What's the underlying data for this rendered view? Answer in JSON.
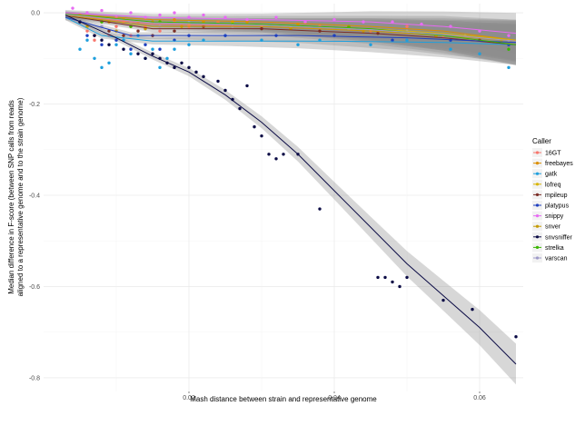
{
  "chart_data": {
    "type": "scatter",
    "title": "",
    "xlabel": "Mash distance between strain and representative genome",
    "ylabel_lines": [
      "Median difference in F-score (between SNP calls from reads",
      "aligned to a representative genome and to the strain genome)"
    ],
    "xlim": [
      0.0,
      0.066
    ],
    "ylim": [
      -0.83,
      0.02
    ],
    "x_ticks": [
      0.02,
      0.04,
      0.06
    ],
    "x_tick_labels": [
      "0.02",
      "0.04",
      "0.06"
    ],
    "y_ticks": [
      0.0,
      -0.2,
      -0.4,
      -0.6,
      -0.8
    ],
    "y_tick_labels": [
      "0.0",
      "-0.2",
      "-0.4",
      "-0.6",
      "-0.8"
    ],
    "grid": true,
    "legend": {
      "title": "Caller",
      "position": "right"
    },
    "series": [
      {
        "name": "16GT",
        "color": "#f8766d",
        "points": [
          [
            0.005,
            -0.01
          ],
          [
            0.006,
            -0.04
          ],
          [
            0.007,
            -0.06
          ],
          [
            0.008,
            -0.02
          ],
          [
            0.009,
            -0.05
          ],
          [
            0.01,
            -0.03
          ],
          [
            0.011,
            -0.02
          ],
          [
            0.012,
            -0.05
          ],
          [
            0.014,
            -0.03
          ],
          [
            0.016,
            -0.04
          ],
          [
            0.018,
            -0.02
          ],
          [
            0.02,
            -0.03
          ],
          [
            0.024,
            -0.02
          ],
          [
            0.03,
            -0.03
          ],
          [
            0.038,
            -0.03
          ],
          [
            0.045,
            -0.04
          ],
          [
            0.05,
            -0.03
          ],
          [
            0.055,
            -0.05
          ],
          [
            0.06,
            -0.06
          ],
          [
            0.064,
            -0.07
          ]
        ],
        "fit": [
          [
            0.003,
            -0.005
          ],
          [
            0.015,
            -0.025
          ],
          [
            0.03,
            -0.03
          ],
          [
            0.045,
            -0.04
          ],
          [
            0.055,
            -0.05
          ],
          [
            0.065,
            -0.07
          ]
        ]
      },
      {
        "name": "freebayes",
        "color": "#db8e00",
        "points": [
          [
            0.005,
            -0.005
          ],
          [
            0.007,
            -0.01
          ],
          [
            0.009,
            -0.02
          ],
          [
            0.011,
            -0.015
          ],
          [
            0.013,
            -0.02
          ],
          [
            0.015,
            -0.02
          ],
          [
            0.018,
            -0.015
          ],
          [
            0.022,
            -0.02
          ],
          [
            0.028,
            -0.02
          ],
          [
            0.035,
            -0.025
          ],
          [
            0.042,
            -0.03
          ],
          [
            0.05,
            -0.04
          ],
          [
            0.058,
            -0.05
          ],
          [
            0.064,
            -0.06
          ]
        ],
        "fit": [
          [
            0.003,
            -0.003
          ],
          [
            0.015,
            -0.015
          ],
          [
            0.03,
            -0.02
          ],
          [
            0.045,
            -0.03
          ],
          [
            0.055,
            -0.04
          ],
          [
            0.065,
            -0.06
          ]
        ]
      },
      {
        "name": "gatk",
        "color": "#1e9fdd",
        "points": [
          [
            0.005,
            -0.08
          ],
          [
            0.006,
            -0.06
          ],
          [
            0.007,
            -0.1
          ],
          [
            0.008,
            -0.12
          ],
          [
            0.009,
            -0.11
          ],
          [
            0.01,
            -0.07
          ],
          [
            0.011,
            -0.06
          ],
          [
            0.012,
            -0.09
          ],
          [
            0.013,
            -0.05
          ],
          [
            0.014,
            -0.1
          ],
          [
            0.015,
            -0.08
          ],
          [
            0.016,
            -0.12
          ],
          [
            0.017,
            -0.1
          ],
          [
            0.018,
            -0.08
          ],
          [
            0.02,
            -0.07
          ],
          [
            0.022,
            -0.06
          ],
          [
            0.025,
            -0.05
          ],
          [
            0.03,
            -0.06
          ],
          [
            0.035,
            -0.07
          ],
          [
            0.038,
            -0.06
          ],
          [
            0.045,
            -0.07
          ],
          [
            0.05,
            -0.06
          ],
          [
            0.056,
            -0.08
          ],
          [
            0.06,
            -0.09
          ],
          [
            0.064,
            -0.12
          ]
        ],
        "fit": [
          [
            0.003,
            -0.01
          ],
          [
            0.008,
            -0.05
          ],
          [
            0.015,
            -0.062
          ],
          [
            0.025,
            -0.062
          ],
          [
            0.035,
            -0.062
          ],
          [
            0.045,
            -0.063
          ],
          [
            0.055,
            -0.065
          ],
          [
            0.065,
            -0.07
          ]
        ]
      },
      {
        "name": "lofreq",
        "color": "#d8b400",
        "points": [
          [
            0.005,
            -0.01
          ],
          [
            0.008,
            -0.02
          ],
          [
            0.012,
            -0.03
          ],
          [
            0.016,
            -0.02
          ],
          [
            0.02,
            -0.025
          ],
          [
            0.026,
            -0.02
          ],
          [
            0.034,
            -0.03
          ],
          [
            0.042,
            -0.03
          ],
          [
            0.05,
            -0.04
          ],
          [
            0.058,
            -0.05
          ],
          [
            0.064,
            -0.06
          ]
        ],
        "fit": [
          [
            0.003,
            -0.004
          ],
          [
            0.015,
            -0.02
          ],
          [
            0.03,
            -0.025
          ],
          [
            0.045,
            -0.035
          ],
          [
            0.055,
            -0.045
          ],
          [
            0.065,
            -0.06
          ]
        ]
      },
      {
        "name": "mpileup",
        "color": "#7b2d26",
        "points": [
          [
            0.005,
            -0.02
          ],
          [
            0.007,
            -0.05
          ],
          [
            0.009,
            -0.04
          ],
          [
            0.011,
            -0.05
          ],
          [
            0.013,
            -0.04
          ],
          [
            0.015,
            -0.05
          ],
          [
            0.018,
            -0.04
          ],
          [
            0.022,
            -0.03
          ],
          [
            0.03,
            -0.035
          ],
          [
            0.038,
            -0.04
          ],
          [
            0.046,
            -0.045
          ],
          [
            0.054,
            -0.05
          ],
          [
            0.06,
            -0.06
          ],
          [
            0.064,
            -0.07
          ]
        ],
        "fit": [
          [
            0.003,
            -0.006
          ],
          [
            0.015,
            -0.035
          ],
          [
            0.03,
            -0.035
          ],
          [
            0.045,
            -0.045
          ],
          [
            0.055,
            -0.055
          ],
          [
            0.065,
            -0.07
          ]
        ]
      },
      {
        "name": "platypus",
        "color": "#1f3fbf",
        "points": [
          [
            0.006,
            -0.05
          ],
          [
            0.008,
            -0.07
          ],
          [
            0.01,
            -0.06
          ],
          [
            0.012,
            -0.08
          ],
          [
            0.014,
            -0.07
          ],
          [
            0.016,
            -0.08
          ],
          [
            0.018,
            -0.06
          ],
          [
            0.02,
            -0.05
          ],
          [
            0.025,
            -0.05
          ],
          [
            0.032,
            -0.05
          ],
          [
            0.04,
            -0.05
          ],
          [
            0.048,
            -0.06
          ],
          [
            0.056,
            -0.06
          ],
          [
            0.064,
            -0.07
          ]
        ],
        "fit": [
          [
            0.003,
            -0.01
          ],
          [
            0.012,
            -0.05
          ],
          [
            0.02,
            -0.05
          ],
          [
            0.035,
            -0.05
          ],
          [
            0.05,
            -0.055
          ],
          [
            0.065,
            -0.065
          ]
        ]
      },
      {
        "name": "snippy",
        "color": "#e76bf3",
        "points": [
          [
            0.004,
            0.01
          ],
          [
            0.006,
            0.0
          ],
          [
            0.008,
            0.005
          ],
          [
            0.01,
            -0.01
          ],
          [
            0.012,
            0.0
          ],
          [
            0.014,
            -0.01
          ],
          [
            0.016,
            -0.005
          ],
          [
            0.018,
            0.0
          ],
          [
            0.02,
            -0.01
          ],
          [
            0.022,
            -0.005
          ],
          [
            0.025,
            -0.01
          ],
          [
            0.028,
            -0.015
          ],
          [
            0.032,
            -0.01
          ],
          [
            0.036,
            -0.02
          ],
          [
            0.04,
            -0.015
          ],
          [
            0.044,
            -0.02
          ],
          [
            0.048,
            -0.02
          ],
          [
            0.052,
            -0.025
          ],
          [
            0.056,
            -0.03
          ],
          [
            0.06,
            -0.04
          ],
          [
            0.064,
            -0.05
          ]
        ],
        "fit": [
          [
            0.003,
            0.0
          ],
          [
            0.015,
            -0.01
          ],
          [
            0.03,
            -0.015
          ],
          [
            0.045,
            -0.02
          ],
          [
            0.055,
            -0.03
          ],
          [
            0.065,
            -0.045
          ]
        ]
      },
      {
        "name": "snver",
        "color": "#c49a00",
        "points": [
          [
            0.006,
            -0.03
          ],
          [
            0.01,
            -0.04
          ],
          [
            0.014,
            -0.035
          ],
          [
            0.019,
            -0.03
          ],
          [
            0.026,
            -0.03
          ],
          [
            0.034,
            -0.035
          ],
          [
            0.044,
            -0.04
          ],
          [
            0.054,
            -0.05
          ],
          [
            0.063,
            -0.06
          ]
        ],
        "fit": [
          [
            0.003,
            -0.005
          ],
          [
            0.015,
            -0.03
          ],
          [
            0.03,
            -0.03
          ],
          [
            0.045,
            -0.04
          ],
          [
            0.055,
            -0.05
          ],
          [
            0.065,
            -0.062
          ]
        ]
      },
      {
        "name": "snvsniffer",
        "color": "#0b0b45",
        "points": [
          [
            0.005,
            -0.02
          ],
          [
            0.007,
            -0.05
          ],
          [
            0.008,
            -0.06
          ],
          [
            0.009,
            -0.07
          ],
          [
            0.011,
            -0.08
          ],
          [
            0.013,
            -0.09
          ],
          [
            0.014,
            -0.1
          ],
          [
            0.015,
            -0.09
          ],
          [
            0.016,
            -0.1
          ],
          [
            0.017,
            -0.11
          ],
          [
            0.018,
            -0.12
          ],
          [
            0.019,
            -0.11
          ],
          [
            0.02,
            -0.12
          ],
          [
            0.021,
            -0.13
          ],
          [
            0.022,
            -0.14
          ],
          [
            0.024,
            -0.15
          ],
          [
            0.025,
            -0.17
          ],
          [
            0.026,
            -0.19
          ],
          [
            0.027,
            -0.21
          ],
          [
            0.028,
            -0.16
          ],
          [
            0.029,
            -0.25
          ],
          [
            0.03,
            -0.27
          ],
          [
            0.031,
            -0.31
          ],
          [
            0.032,
            -0.32
          ],
          [
            0.033,
            -0.31
          ],
          [
            0.035,
            -0.31
          ],
          [
            0.038,
            -0.43
          ],
          [
            0.046,
            -0.58
          ],
          [
            0.047,
            -0.58
          ],
          [
            0.048,
            -0.59
          ],
          [
            0.049,
            -0.6
          ],
          [
            0.05,
            -0.58
          ],
          [
            0.055,
            -0.63
          ],
          [
            0.059,
            -0.65
          ],
          [
            0.065,
            -0.71
          ]
        ],
        "fit": [
          [
            0.003,
            -0.005
          ],
          [
            0.01,
            -0.055
          ],
          [
            0.015,
            -0.095
          ],
          [
            0.02,
            -0.13
          ],
          [
            0.025,
            -0.18
          ],
          [
            0.03,
            -0.24
          ],
          [
            0.035,
            -0.31
          ],
          [
            0.04,
            -0.39
          ],
          [
            0.045,
            -0.47
          ],
          [
            0.05,
            -0.55
          ],
          [
            0.055,
            -0.62
          ],
          [
            0.06,
            -0.69
          ],
          [
            0.065,
            -0.77
          ]
        ]
      },
      {
        "name": "strelka",
        "color": "#39b600",
        "points": [
          [
            0.005,
            -0.01
          ],
          [
            0.008,
            -0.02
          ],
          [
            0.012,
            -0.03
          ],
          [
            0.016,
            -0.02
          ],
          [
            0.02,
            -0.02
          ],
          [
            0.026,
            -0.025
          ],
          [
            0.034,
            -0.03
          ],
          [
            0.042,
            -0.03
          ],
          [
            0.05,
            -0.04
          ],
          [
            0.058,
            -0.05
          ],
          [
            0.064,
            -0.08
          ]
        ],
        "fit": [
          [
            0.003,
            -0.003
          ],
          [
            0.015,
            -0.02
          ],
          [
            0.03,
            -0.025
          ],
          [
            0.045,
            -0.035
          ],
          [
            0.055,
            -0.05
          ],
          [
            0.065,
            -0.07
          ]
        ]
      },
      {
        "name": "varscan",
        "color": "#9e9ac8",
        "points": [
          [
            0.005,
            -0.01
          ],
          [
            0.008,
            -0.03
          ],
          [
            0.012,
            -0.02
          ],
          [
            0.016,
            -0.03
          ],
          [
            0.02,
            -0.02
          ],
          [
            0.026,
            -0.03
          ],
          [
            0.034,
            -0.03
          ],
          [
            0.042,
            -0.035
          ],
          [
            0.05,
            -0.04
          ],
          [
            0.058,
            -0.05
          ],
          [
            0.064,
            -0.06
          ]
        ],
        "fit": [
          [
            0.003,
            -0.004
          ],
          [
            0.015,
            -0.022
          ],
          [
            0.03,
            -0.027
          ],
          [
            0.045,
            -0.037
          ],
          [
            0.055,
            -0.048
          ],
          [
            0.065,
            -0.062
          ]
        ]
      }
    ]
  }
}
